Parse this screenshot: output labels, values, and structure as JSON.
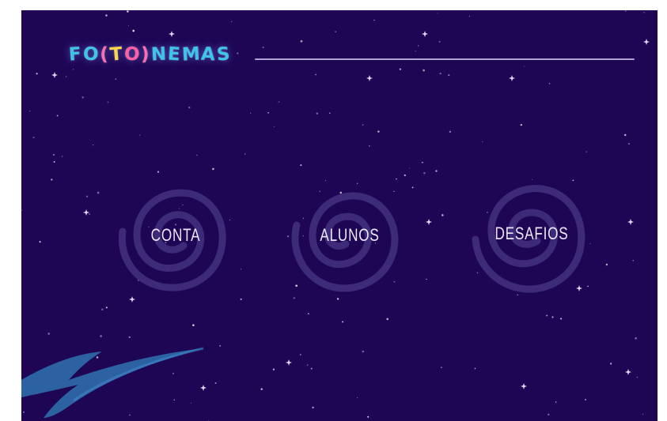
{
  "app": {
    "logo_letters": [
      {
        "ch": "F",
        "color": "#3fc4e8"
      },
      {
        "ch": "O",
        "color": "#3fc4e8"
      },
      {
        "ch": "(",
        "color": "#ff6fb0"
      },
      {
        "ch": "T",
        "color": "#ffd54a"
      },
      {
        "ch": "O",
        "color": "#ff5fa0"
      },
      {
        "ch": ")",
        "color": "#ff6fb0"
      },
      {
        "ch": "N",
        "color": "#3fc4e8"
      },
      {
        "ch": "E",
        "color": "#3fc4e8"
      },
      {
        "ch": "M",
        "color": "#3fc4e8"
      },
      {
        "ch": "A",
        "color": "#3fc4e8"
      },
      {
        "ch": "S",
        "color": "#3fc4e8"
      }
    ]
  },
  "menu": {
    "items": [
      {
        "label": "CONTA"
      },
      {
        "label": "ALUNOS"
      },
      {
        "label": "DESAFIOS"
      }
    ]
  },
  "colors": {
    "background": "#1f0655",
    "spiral": "#3d2a78",
    "star": "#e8d9f2",
    "swoosh": "#2d6cab",
    "underline": "#c8bfea"
  }
}
